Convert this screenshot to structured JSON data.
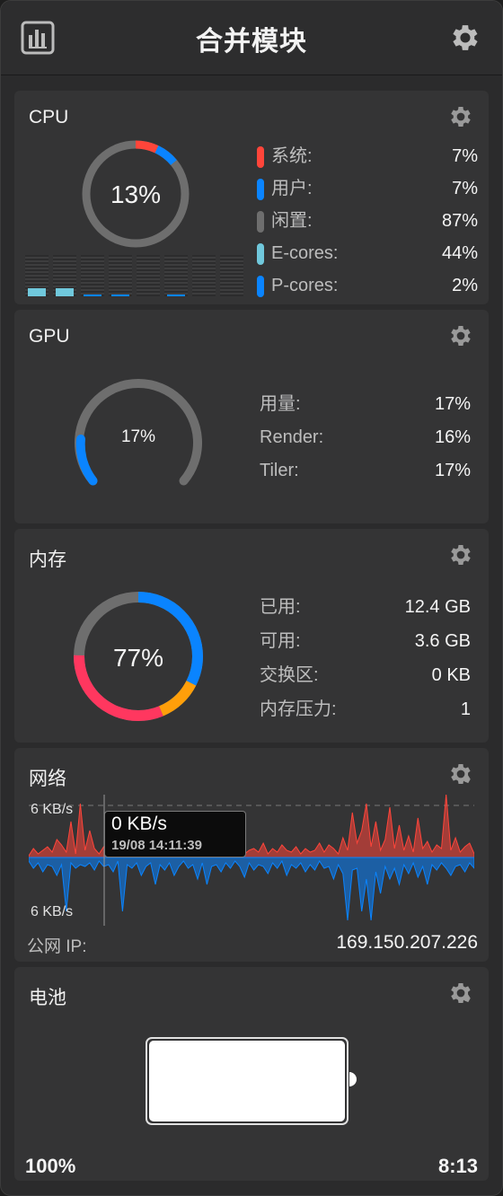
{
  "header": {
    "title": "合并模块"
  },
  "cpu": {
    "title": "CPU",
    "percent": "13%",
    "stats": [
      {
        "label": "系统:",
        "value": "7%",
        "color": "#ff453a"
      },
      {
        "label": "用户:",
        "value": "7%",
        "color": "#0a84ff"
      },
      {
        "label": "闲置:",
        "value": "87%",
        "color": "#6e6e6e"
      },
      {
        "label": "E-cores:",
        "value": "44%",
        "color": "#70c8dc"
      },
      {
        "label": "P-cores:",
        "value": "2%",
        "color": "#0a84ff"
      }
    ],
    "core_loads": [
      0.25,
      0.25,
      0.04,
      0.04,
      0.0,
      0.02,
      0.0,
      0.0
    ]
  },
  "gpu": {
    "title": "GPU",
    "percent": "17%",
    "stats": [
      {
        "label": "用量:",
        "value": "17%"
      },
      {
        "label": "Render:",
        "value": "16%"
      },
      {
        "label": "Tiler:",
        "value": "17%"
      }
    ]
  },
  "memory": {
    "title": "内存",
    "percent": "77%",
    "stats": [
      {
        "label": "已用:",
        "value": "12.4 GB"
      },
      {
        "label": "可用:",
        "value": "3.6 GB"
      },
      {
        "label": "交换区:",
        "value": "0 KB"
      },
      {
        "label": "内存压力:",
        "value": "1"
      }
    ]
  },
  "network": {
    "title": "网络",
    "scale_top": "6 KB/s",
    "scale_bottom": "6 KB/s",
    "tooltip_value": "0 KB/s",
    "tooltip_time": "19/08 14:11:39",
    "ip_label": "公网 IP:",
    "ip_value": "169.150.207.226"
  },
  "battery": {
    "title": "电池",
    "percent": "100%",
    "time": "8:13",
    "level": 1.0
  }
}
